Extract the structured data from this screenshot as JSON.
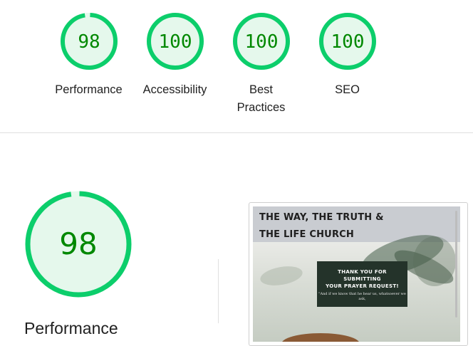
{
  "summary_gauges": [
    {
      "score": "98",
      "label_lines": [
        "Performance"
      ]
    },
    {
      "score": "100",
      "label_lines": [
        "Accessibility"
      ]
    },
    {
      "score": "100",
      "label_lines": [
        "Best",
        "Practices"
      ]
    },
    {
      "score": "100",
      "label_lines": [
        "SEO"
      ]
    }
  ],
  "detail": {
    "score": "98",
    "score_fraction": 0.98,
    "title": "Performance"
  },
  "screenshot": {
    "header_line1": "THE WAY, THE TRUTH &",
    "header_line2": "THE LIFE CHURCH",
    "card_line1": "THANK YOU FOR",
    "card_line2": "SUBMITTING",
    "card_line3": "YOUR PRAYER REQUEST!",
    "card_quote_line1": "\"And if we know that he hear us, whatsoever we",
    "card_quote_line2": "ask,"
  },
  "colors": {
    "pass_green": "#0cce6b",
    "pass_fill": "#e5f8ec",
    "pass_text": "#008800"
  },
  "score_fractions": [
    0.98,
    1.0,
    1.0,
    1.0
  ]
}
